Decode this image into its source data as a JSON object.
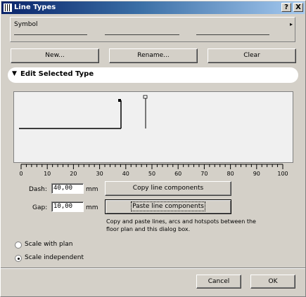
{
  "window": {
    "title": "Line Types"
  },
  "titlebar_buttons": {
    "help": "?",
    "close": "X"
  },
  "symbol": {
    "label": "Symbol",
    "arrow": "▸"
  },
  "buttons": {
    "new": "New...",
    "rename": "Rename...",
    "clear": "Clear"
  },
  "section": {
    "title": "Edit Selected Type"
  },
  "ruler": {
    "ticks": [
      "0",
      "10",
      "20",
      "30",
      "40",
      "50",
      "60",
      "70",
      "80",
      "90",
      "100"
    ]
  },
  "dash": {
    "label": "Dash:",
    "value": "40,00",
    "unit": "mm"
  },
  "gap": {
    "label": "Gap:",
    "value": "10,00",
    "unit": "mm"
  },
  "copy_button": "Copy line components",
  "paste_button": "Paste line components",
  "help_text": "Copy and paste lines, arcs and hotspots between the floor plan and this dialog box.",
  "scale": {
    "with_plan": "Scale with plan",
    "independent": "Scale independent",
    "selected": "independent"
  },
  "footer": {
    "cancel": "Cancel",
    "ok": "OK"
  }
}
